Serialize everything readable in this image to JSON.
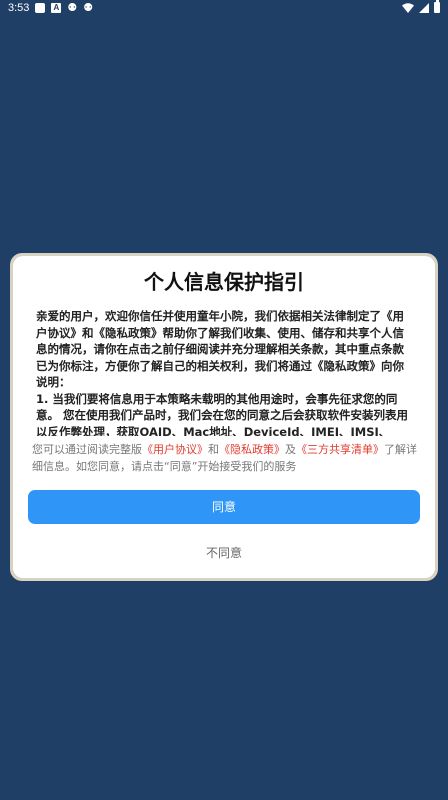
{
  "status_bar": {
    "time": "3:53",
    "icons": [
      "square-icon",
      "a-box-icon",
      "bug-icon",
      "bug-icon",
      "wifi-icon",
      "signal-icon",
      "battery-icon"
    ]
  },
  "dialog": {
    "title": "个人信息保护指引",
    "paragraphs": [
      "亲爱的用户，欢迎你信任并使用童年小院，我们依据相关法律制定了《用户协议》和《隐私政策》帮助你了解我们收集、使用、储存和共享个人信息的情况，请你在点击之前仔细阅读并充分理解相关条款，其中重点条款已为你标注，方便你了解自己的相关权利，我们将通过《隐私政策》向你说明：",
      "1. 当我们要将信息用于本策略未载明的其他用途时，会事先征求您的同意。 您在使用我们产品时，我们会在您的同意之后会获取软件安装列表用以反作弊处理，获取OAID、Mac地址、DeviceId、IMEI、IMSI、"
    ],
    "summary": {
      "prefix": "您可以通过阅读完整版",
      "link_user": "《用户协议》",
      "and": "和",
      "link_privacy": "《隐私政策》",
      "and2": "及",
      "link_share": "《三方共享清单》",
      "suffix": "了解详细信息。如您同意，请点击“同意”开始接受我们的服务"
    },
    "agree_label": "同意",
    "disagree_label": "不同意"
  },
  "colors": {
    "background": "#1f3f66",
    "accent": "#2f96f7",
    "link": "#e23b2e"
  }
}
